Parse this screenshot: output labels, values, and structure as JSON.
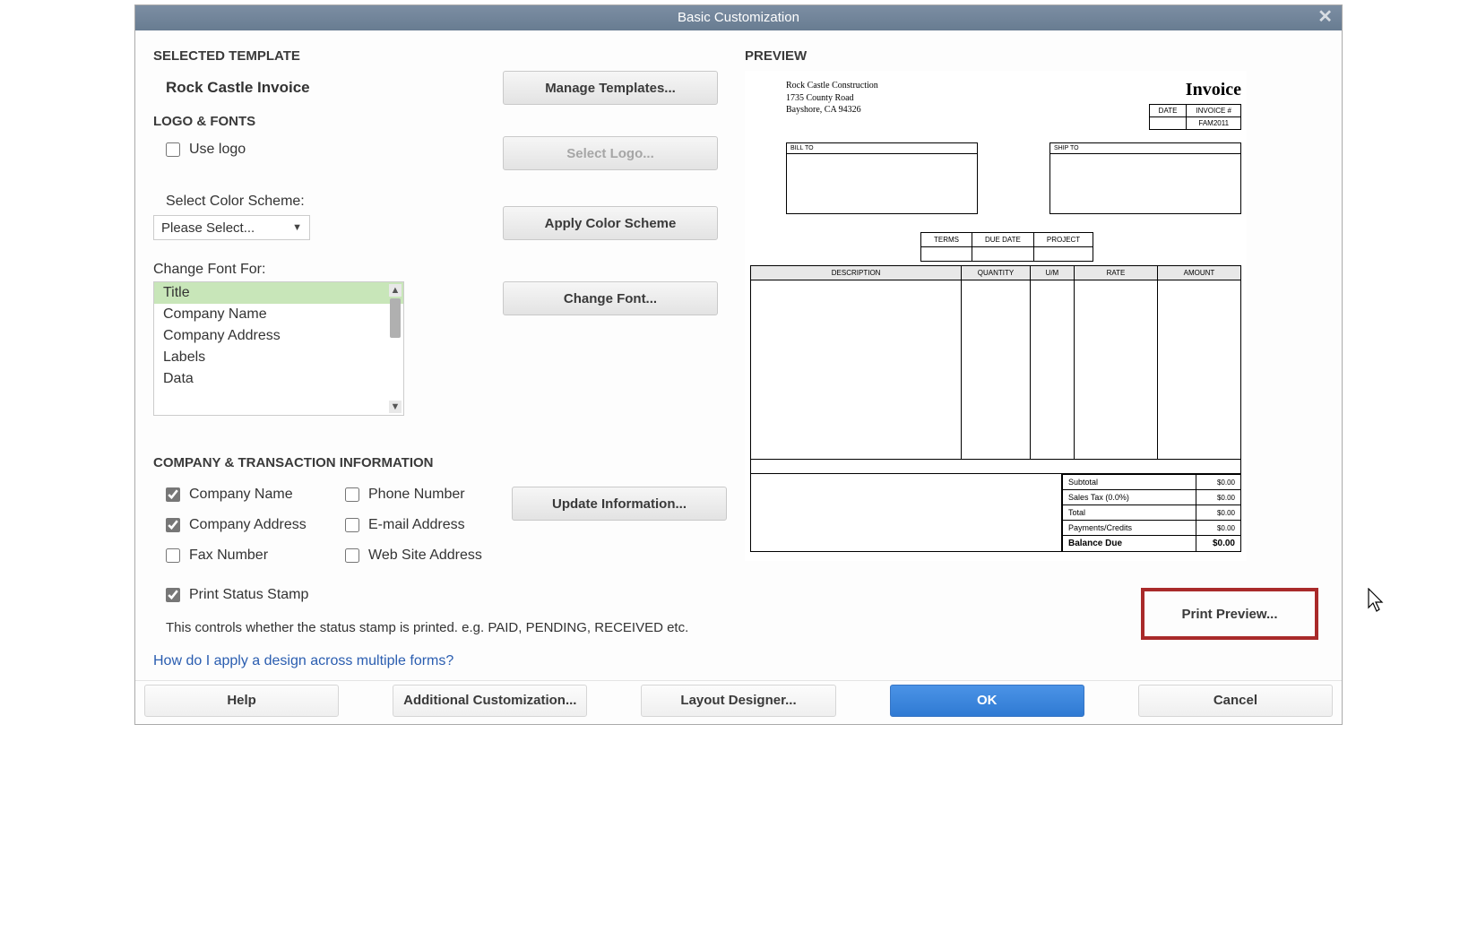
{
  "window": {
    "title": "Basic Customization"
  },
  "sections": {
    "selectedTemplate": "SELECTED TEMPLATE",
    "logoFonts": "LOGO & FONTS",
    "companyInfo": "COMPANY & TRANSACTION INFORMATION",
    "preview": "PREVIEW"
  },
  "template": {
    "name": "Rock Castle Invoice",
    "manageBtn": "Manage Templates..."
  },
  "logo": {
    "useLogoLabel": "Use logo",
    "selectLogoBtn": "Select Logo..."
  },
  "colorScheme": {
    "label": "Select Color Scheme:",
    "value": "Please Select...",
    "applyBtn": "Apply Color Scheme"
  },
  "font": {
    "label": "Change Font For:",
    "options": [
      "Title",
      "Company Name",
      "Company Address",
      "Labels",
      "Data"
    ],
    "selectedIndex": 0,
    "changeBtn": "Change Font..."
  },
  "info": {
    "companyName": "Company Name",
    "companyAddress": "Company Address",
    "faxNumber": "Fax Number",
    "phoneNumber": "Phone Number",
    "emailAddress": "E-mail Address",
    "webSiteAddress": "Web Site Address",
    "printStatusStamp": "Print Status Stamp",
    "updateBtn": "Update Information...",
    "hint": "This controls whether the status stamp is printed. e.g. PAID, PENDING, RECEIVED etc."
  },
  "helpLink": "How do I apply a design across multiple forms?",
  "invoice": {
    "company": {
      "name": "Rock Castle Construction",
      "addr1": "1735 County Road",
      "addr2": "Bayshore, CA 94326"
    },
    "title": "Invoice",
    "meta": {
      "dateLabel": "DATE",
      "invNoLabel": "INVOICE #",
      "invNoValue": "FAM2011"
    },
    "billTo": "BILL TO",
    "shipTo": "SHIP TO",
    "terms": {
      "terms": "TERMS",
      "dueDate": "DUE DATE",
      "project": "PROJECT"
    },
    "cols": {
      "desc": "DESCRIPTION",
      "qty": "QUANTITY",
      "um": "U/M",
      "rate": "RATE",
      "amount": "AMOUNT"
    },
    "totals": {
      "subtotal": "Subtotal",
      "subtotalVal": "$0.00",
      "salesTax": "Sales Tax (0.0%)",
      "salesTaxVal": "$0.00",
      "total": "Total",
      "totalVal": "$0.00",
      "payments": "Payments/Credits",
      "paymentsVal": "$0.00",
      "balance": "Balance Due",
      "balanceVal": "$0.00"
    }
  },
  "printPreview": "Print Preview...",
  "footer": {
    "help": "Help",
    "additional": "Additional Customization...",
    "layout": "Layout Designer...",
    "ok": "OK",
    "cancel": "Cancel"
  }
}
